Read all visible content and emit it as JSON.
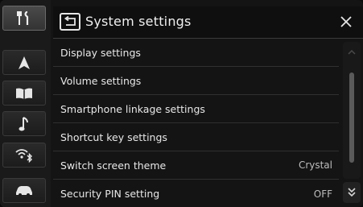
{
  "header": {
    "title": "System settings"
  },
  "rail": {
    "items": [
      {
        "icon": "settings-tools-icon",
        "active": true
      },
      {
        "icon": "navigation-arrow-icon",
        "active": false
      },
      {
        "icon": "open-book-icon",
        "active": false
      },
      {
        "icon": "music-note-icon",
        "active": false
      },
      {
        "icon": "wifi-bluetooth-icon",
        "active": false
      },
      {
        "icon": "car-icon",
        "active": false
      }
    ]
  },
  "list": {
    "items": [
      {
        "label": "Display settings",
        "value": ""
      },
      {
        "label": "Volume settings",
        "value": ""
      },
      {
        "label": "Smartphone linkage settings",
        "value": ""
      },
      {
        "label": "Shortcut key settings",
        "value": ""
      },
      {
        "label": "Switch screen theme",
        "value": "Crystal"
      },
      {
        "label": "Security PIN setting",
        "value": "OFF"
      }
    ]
  },
  "colors": {
    "background": "#141414",
    "rail": "#1a1a1a",
    "text": "#e8e8e8",
    "muted": "#bdbdbd"
  }
}
